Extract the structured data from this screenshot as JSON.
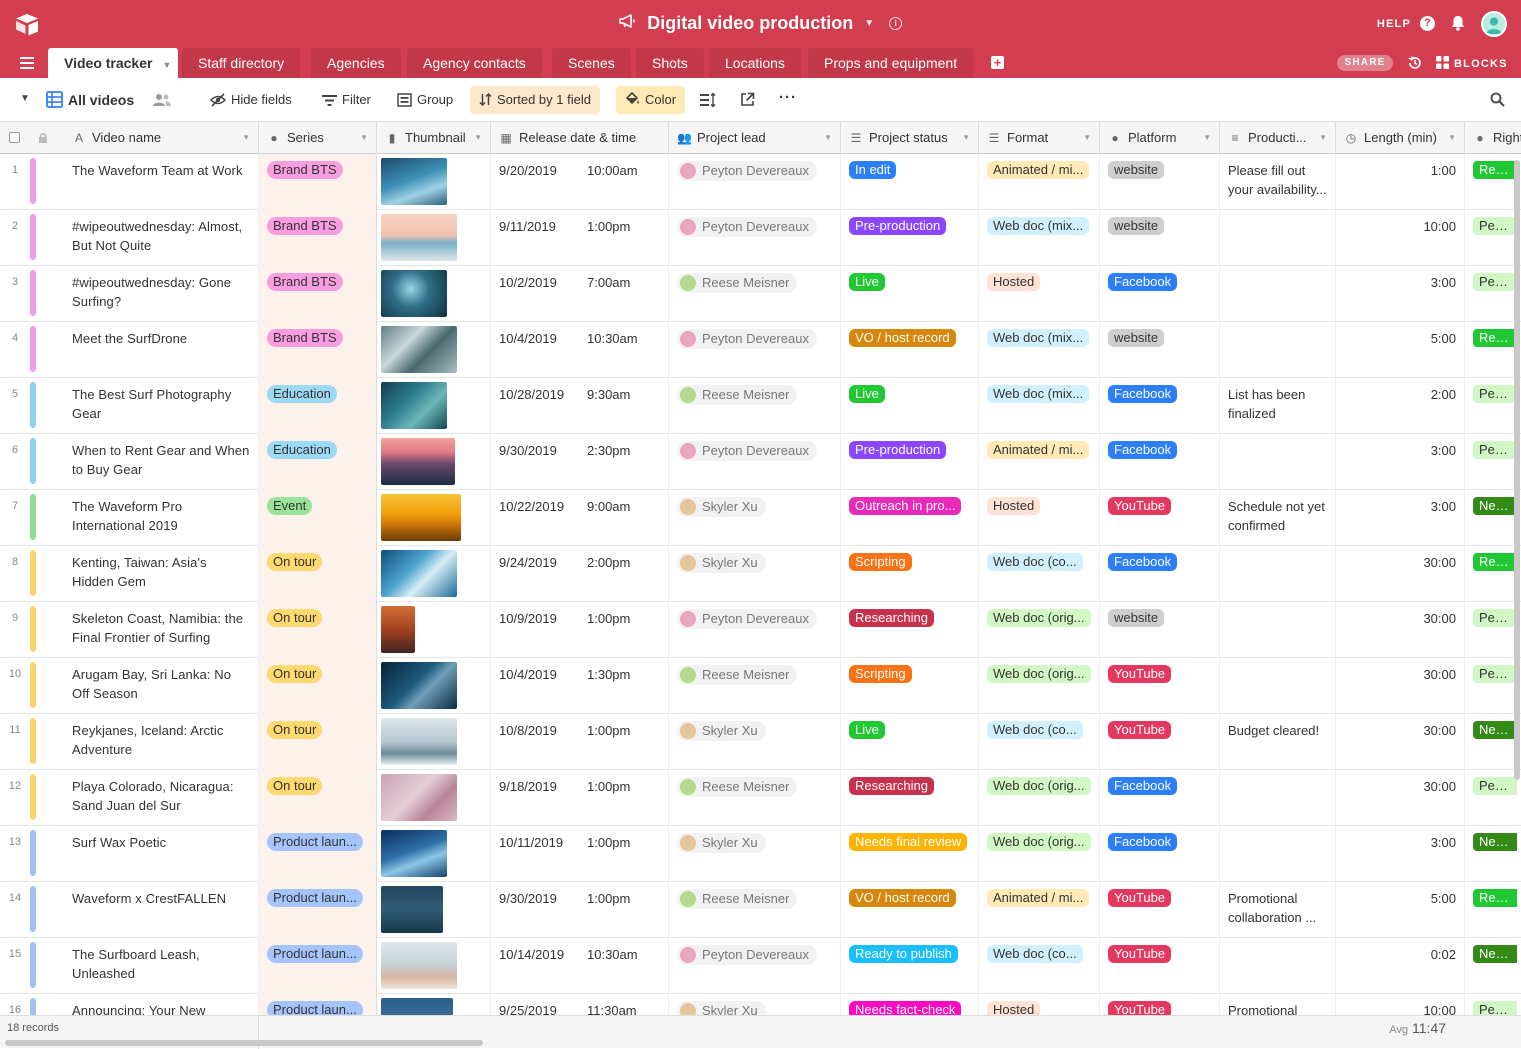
{
  "app": {
    "base_title": "Digital video production",
    "help_label": "HELP",
    "help_glyph": "?",
    "share_label": "SHARE",
    "blocks_label": "BLOCKS",
    "add_glyph": "+",
    "brand_color": "#d33d50"
  },
  "tabs": [
    {
      "label": "Video tracker",
      "active": true
    },
    {
      "label": "Staff directory"
    },
    {
      "label": "Agencies"
    },
    {
      "label": "Agency contacts"
    },
    {
      "label": "Scenes"
    },
    {
      "label": "Shots"
    },
    {
      "label": "Locations"
    },
    {
      "label": "Props and equipment"
    }
  ],
  "toolbar": {
    "view_name": "All videos",
    "hide_fields": "Hide fields",
    "filter": "Filter",
    "group": "Group",
    "sort": "Sorted by 1 field",
    "color": "Color"
  },
  "columns": {
    "name": "Video name",
    "series": "Series",
    "thumbnail": "Thumbnail",
    "release": "Release date & time",
    "lead": "Project lead",
    "status": "Project status",
    "format": "Format",
    "platform": "Platform",
    "production": "Producti...",
    "length": "Length (min)",
    "rights": "Right"
  },
  "palette": {
    "series": {
      "Brand BTS": {
        "bg": "#f99de2",
        "fg": "#333",
        "bar": "#ee9de7"
      },
      "Education": {
        "bg": "#9cd9f5",
        "fg": "#333",
        "bar": "#8ad3f1"
      },
      "Event": {
        "bg": "#9be29a",
        "fg": "#333",
        "bar": "#93dc94"
      },
      "On tour": {
        "bg": "#fdd96f",
        "fg": "#333",
        "bar": "#fbd56b"
      },
      "Product laun...": {
        "bg": "#a5c4fb",
        "fg": "#333",
        "bar": "#9fc0f5"
      }
    },
    "status": {
      "In edit": "#2d7ff9",
      "Pre-production": "#8b46ff",
      "Live": "#20c933",
      "VO / host record": "#d6870c",
      "Outreach in pro...": "#e929ba",
      "Scripting": "#f97316",
      "Researching": "#c8314b",
      "Needs final review": "#fcb400",
      "Ready to publish": "#18bfff",
      "Needs fact-check": "#ff08c2"
    },
    "format": {
      "Animated / mi...": "#ffeab6",
      "Web doc (mix...": "#d0f0fd",
      "Hosted": "#fee2d5",
      "Web doc (co...": "#d0f0fd",
      "Web doc (orig...": "#d1f7c4"
    },
    "platform": {
      "website": {
        "bg": "#cfcfcf",
        "fg": "#333"
      },
      "Facebook": {
        "bg": "#2d7ff9",
        "fg": "#fff"
      },
      "YouTube": {
        "bg": "#e4385e",
        "fg": "#fff"
      }
    },
    "rights": {
      "Ready": {
        "bg": "#20c933",
        "fg": "#fff"
      },
      "Permis": {
        "bg": "#d1f7c4",
        "fg": "#333"
      },
      "Needs": {
        "bg": "#338a17",
        "fg": "#fff"
      }
    }
  },
  "rows": [
    {
      "num": "1",
      "name": "The Waveform Team at Work",
      "series": "Brand BTS",
      "thumb": "wave-blue",
      "date": "9/20/2019",
      "time": "10:00am",
      "lead": "Peyton Devereaux",
      "lead_avatar": "pink",
      "status": "In edit",
      "format": "Animated / mi...",
      "platform": "website",
      "production": "Please fill out your availability...",
      "length": "1:00",
      "rights": "Ready"
    },
    {
      "num": "2",
      "name": "#wipeoutwednesday: Almost, But Not Quite",
      "series": "Brand BTS",
      "thumb": "beach-pink",
      "date": "9/11/2019",
      "time": "1:00pm",
      "lead": "Peyton Devereaux",
      "lead_avatar": "pink",
      "status": "Pre-production",
      "format": "Web doc (mix...",
      "platform": "website",
      "production": "",
      "length": "10:00",
      "rights": "Permis"
    },
    {
      "num": "3",
      "name": "#wipeoutwednesday: Gone Surfing?",
      "series": "Brand BTS",
      "thumb": "barrel-dark",
      "date": "10/2/2019",
      "time": "7:00am",
      "lead": "Reese Meisner",
      "lead_avatar": "green",
      "status": "Live",
      "format": "Hosted",
      "platform": "Facebook",
      "production": "",
      "length": "3:00",
      "rights": "Permis"
    },
    {
      "num": "4",
      "name": "Meet the SurfDrone",
      "series": "Brand BTS",
      "thumb": "foam-gray",
      "date": "10/4/2019",
      "time": "10:30am",
      "lead": "Peyton Devereaux",
      "lead_avatar": "pink",
      "status": "VO / host record",
      "format": "Web doc (mix...",
      "platform": "website",
      "production": "",
      "length": "5:00",
      "rights": "Ready"
    },
    {
      "num": "5",
      "name": "The Best Surf Photography Gear",
      "series": "Education",
      "thumb": "teal-wave",
      "date": "10/28/2019",
      "time": "9:30am",
      "lead": "Reese Meisner",
      "lead_avatar": "green",
      "status": "Live",
      "format": "Web doc (mix...",
      "platform": "Facebook",
      "production": "List has been finalized",
      "length": "2:00",
      "rights": "Permis"
    },
    {
      "num": "6",
      "name": "When to Rent Gear and When to Buy Gear",
      "series": "Education",
      "thumb": "sunset-surfer",
      "date": "9/30/2019",
      "time": "2:30pm",
      "lead": "Peyton Devereaux",
      "lead_avatar": "pink",
      "status": "Pre-production",
      "format": "Animated / mi...",
      "platform": "Facebook",
      "production": "",
      "length": "3:00",
      "rights": "Permis"
    },
    {
      "num": "7",
      "name": "The Waveform Pro International 2019",
      "series": "Event",
      "thumb": "golden-sunset",
      "date": "10/22/2019",
      "time": "9:00am",
      "lead": "Skyler Xu",
      "lead_avatar": "tan",
      "status": "Outreach in pro...",
      "format": "Hosted",
      "platform": "YouTube",
      "production": "Schedule not yet confirmed",
      "length": "3:00",
      "rights": "Needs"
    },
    {
      "num": "8",
      "name": "Kenting, Taiwan: Asia's Hidden Gem",
      "series": "On tour",
      "thumb": "blue-curl",
      "date": "9/24/2019",
      "time": "2:00pm",
      "lead": "Skyler Xu",
      "lead_avatar": "tan",
      "status": "Scripting",
      "format": "Web doc (co...",
      "platform": "Facebook",
      "production": "",
      "length": "30:00",
      "rights": "Ready"
    },
    {
      "num": "9",
      "name": "Skeleton Coast, Namibia: the Final Frontier of Surfing",
      "series": "On tour",
      "thumb": "red-rocks",
      "date": "10/9/2019",
      "time": "1:00pm",
      "lead": "Peyton Devereaux",
      "lead_avatar": "pink",
      "status": "Researching",
      "format": "Web doc (orig...",
      "platform": "website",
      "production": "",
      "length": "30:00",
      "rights": "Permis"
    },
    {
      "num": "10",
      "name": "Arugam Bay, Sri Lanka: No Off Season",
      "series": "On tour",
      "thumb": "navy-wave",
      "date": "10/4/2019",
      "time": "1:30pm",
      "lead": "Reese Meisner",
      "lead_avatar": "green",
      "status": "Scripting",
      "format": "Web doc (orig...",
      "platform": "YouTube",
      "production": "",
      "length": "30:00",
      "rights": "Permis"
    },
    {
      "num": "11",
      "name": "Reykjanes, Iceland: Arctic Adventure",
      "series": "On tour",
      "thumb": "pale-sea",
      "date": "10/8/2019",
      "time": "1:00pm",
      "lead": "Skyler Xu",
      "lead_avatar": "tan",
      "status": "Live",
      "format": "Web doc (co...",
      "platform": "YouTube",
      "production": "Budget cleared!",
      "length": "30:00",
      "rights": "Needs"
    },
    {
      "num": "12",
      "name": "Playa Colorado, Nicaragua: Sand Juan del Sur",
      "series": "On tour",
      "thumb": "pink-sea",
      "date": "9/18/2019",
      "time": "1:00pm",
      "lead": "Reese Meisner",
      "lead_avatar": "green",
      "status": "Researching",
      "format": "Web doc (orig...",
      "platform": "Facebook",
      "production": "",
      "length": "30:00",
      "rights": "Permis"
    },
    {
      "num": "13",
      "name": "Surf Wax Poetic",
      "series": "Product laun...",
      "thumb": "deep-blue",
      "date": "10/11/2019",
      "time": "1:00pm",
      "lead": "Skyler Xu",
      "lead_avatar": "tan",
      "status": "Needs final review",
      "format": "Web doc (orig...",
      "platform": "Facebook",
      "production": "",
      "length": "3:00",
      "rights": "Needs"
    },
    {
      "num": "14",
      "name": "Waveform x CrestFALLEN",
      "series": "Product laun...",
      "thumb": "dark-surfer",
      "date": "9/30/2019",
      "time": "1:00pm",
      "lead": "Reese Meisner",
      "lead_avatar": "green",
      "status": "VO / host record",
      "format": "Animated / mi...",
      "platform": "YouTube",
      "production": "Promotional collaboration ...",
      "length": "5:00",
      "rights": "Ready"
    },
    {
      "num": "15",
      "name": "The Surfboard Leash, Unleashed",
      "series": "Product laun...",
      "thumb": "beach-board",
      "date": "10/14/2019",
      "time": "10:30am",
      "lead": "Peyton Devereaux",
      "lead_avatar": "pink",
      "status": "Ready to publish",
      "format": "Web doc (co...",
      "platform": "YouTube",
      "production": "",
      "length": "0:02",
      "rights": "Needs"
    },
    {
      "num": "16",
      "name": "Announcing: Your New",
      "series": "Product laun...",
      "thumb": "ocean-strip",
      "date": "9/25/2019",
      "time": "11:30am",
      "lead": "Skyler Xu",
      "lead_avatar": "tan",
      "status": "Needs fact-check",
      "format": "Hosted",
      "platform": "YouTube",
      "production": "Promotional",
      "length": "10:00",
      "rights": "Permis"
    }
  ],
  "footer": {
    "records": "18 records",
    "avg_label": "Avg",
    "avg_value": "11:47"
  }
}
